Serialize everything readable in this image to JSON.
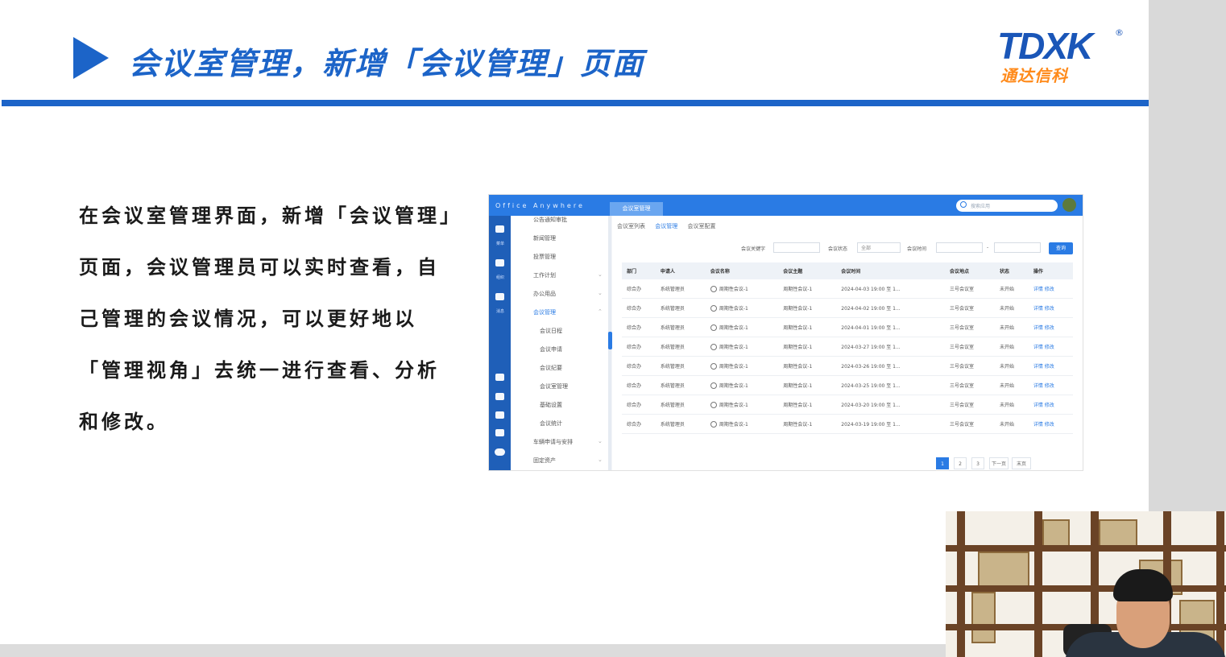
{
  "slide": {
    "title": "会议室管理，新增「会议管理」页面",
    "logo_mark": "TDXK",
    "logo_reg": "®",
    "logo_cn": "通达信科",
    "body_lines": [
      "在会议室管理界面，新增「会议管理」",
      "页面，会议管理员可以实时查看，自",
      "己管理的会议情况，可以更好地以",
      "「管理视角」去统一进行查看、分析",
      "和修改。"
    ]
  },
  "screenshot": {
    "brand": "Office Anywhere",
    "active_tab": "会议室管理",
    "search_placeholder": "搜索应用",
    "rail_labels": [
      "菜单",
      "组织",
      "消息"
    ],
    "menu": [
      {
        "label": "公告通知审批",
        "sub": false,
        "active": false,
        "chevron": ""
      },
      {
        "label": "新闻管理",
        "sub": false,
        "active": false,
        "chevron": ""
      },
      {
        "label": "投票管理",
        "sub": false,
        "active": false,
        "chevron": ""
      },
      {
        "label": "工作计划",
        "sub": false,
        "active": false,
        "chevron": "⌄"
      },
      {
        "label": "办公用品",
        "sub": false,
        "active": false,
        "chevron": "⌄"
      },
      {
        "label": "会议管理",
        "sub": false,
        "active": true,
        "chevron": "⌃"
      },
      {
        "label": "会议日程",
        "sub": true,
        "active": false,
        "chevron": ""
      },
      {
        "label": "会议申请",
        "sub": true,
        "active": false,
        "chevron": ""
      },
      {
        "label": "会议纪要",
        "sub": true,
        "active": false,
        "chevron": ""
      },
      {
        "label": "会议室管理",
        "sub": true,
        "active": false,
        "chevron": ""
      },
      {
        "label": "基础设置",
        "sub": true,
        "active": false,
        "chevron": ""
      },
      {
        "label": "会议统计",
        "sub": true,
        "active": false,
        "chevron": ""
      },
      {
        "label": "车辆申请与安排",
        "sub": false,
        "active": false,
        "chevron": "⌄"
      },
      {
        "label": "固定资产",
        "sub": false,
        "active": false,
        "chevron": "⌄"
      }
    ],
    "crumbs": [
      "会议室列表",
      "会议管理",
      "会议室配置"
    ],
    "filters": {
      "keyword_label": "会议关键字",
      "status_label": "会议状态",
      "status_value": "全部",
      "time_label": "会议时间",
      "range_sep": "-",
      "query_button": "查询"
    },
    "table": {
      "headers": [
        "部门",
        "申请人",
        "会议名称",
        "会议主题",
        "会议时间",
        "会议地点",
        "状态",
        "操作"
      ],
      "rows": [
        [
          "综合办",
          "系统管理员",
          "周期性会议-1",
          "周期性会议-1",
          "2024-04-03 19:00 至 1...",
          "三号会议室",
          "未开始",
          "详情  修改"
        ],
        [
          "综合办",
          "系统管理员",
          "周期性会议-1",
          "周期性会议-1",
          "2024-04-02 19:00 至 1...",
          "三号会议室",
          "未开始",
          "详情  修改"
        ],
        [
          "综合办",
          "系统管理员",
          "周期性会议-1",
          "周期性会议-1",
          "2024-04-01 19:00 至 1...",
          "三号会议室",
          "未开始",
          "详情  修改"
        ],
        [
          "综合办",
          "系统管理员",
          "周期性会议-1",
          "周期性会议-1",
          "2024-03-27 19:00 至 1...",
          "三号会议室",
          "未开始",
          "详情  修改"
        ],
        [
          "综合办",
          "系统管理员",
          "周期性会议-1",
          "周期性会议-1",
          "2024-03-26 19:00 至 1...",
          "三号会议室",
          "未开始",
          "详情  修改"
        ],
        [
          "综合办",
          "系统管理员",
          "周期性会议-1",
          "周期性会议-1",
          "2024-03-25 19:00 至 1...",
          "三号会议室",
          "未开始",
          "详情  修改"
        ],
        [
          "综合办",
          "系统管理员",
          "周期性会议-1",
          "周期性会议-1",
          "2024-03-20 19:00 至 1...",
          "三号会议室",
          "未开始",
          "详情  修改"
        ],
        [
          "综合办",
          "系统管理员",
          "周期性会议-1",
          "周期性会议-1",
          "2024-03-19 19:00 至 1...",
          "三号会议室",
          "未开始",
          "详情  修改"
        ]
      ]
    },
    "pagination": [
      "1",
      "2",
      "3",
      "下一页",
      "末页"
    ],
    "accent_color": "#2a7be4"
  },
  "colors": {
    "title_blue": "#1c64c8",
    "logo_orange": "#ff8a1a"
  }
}
